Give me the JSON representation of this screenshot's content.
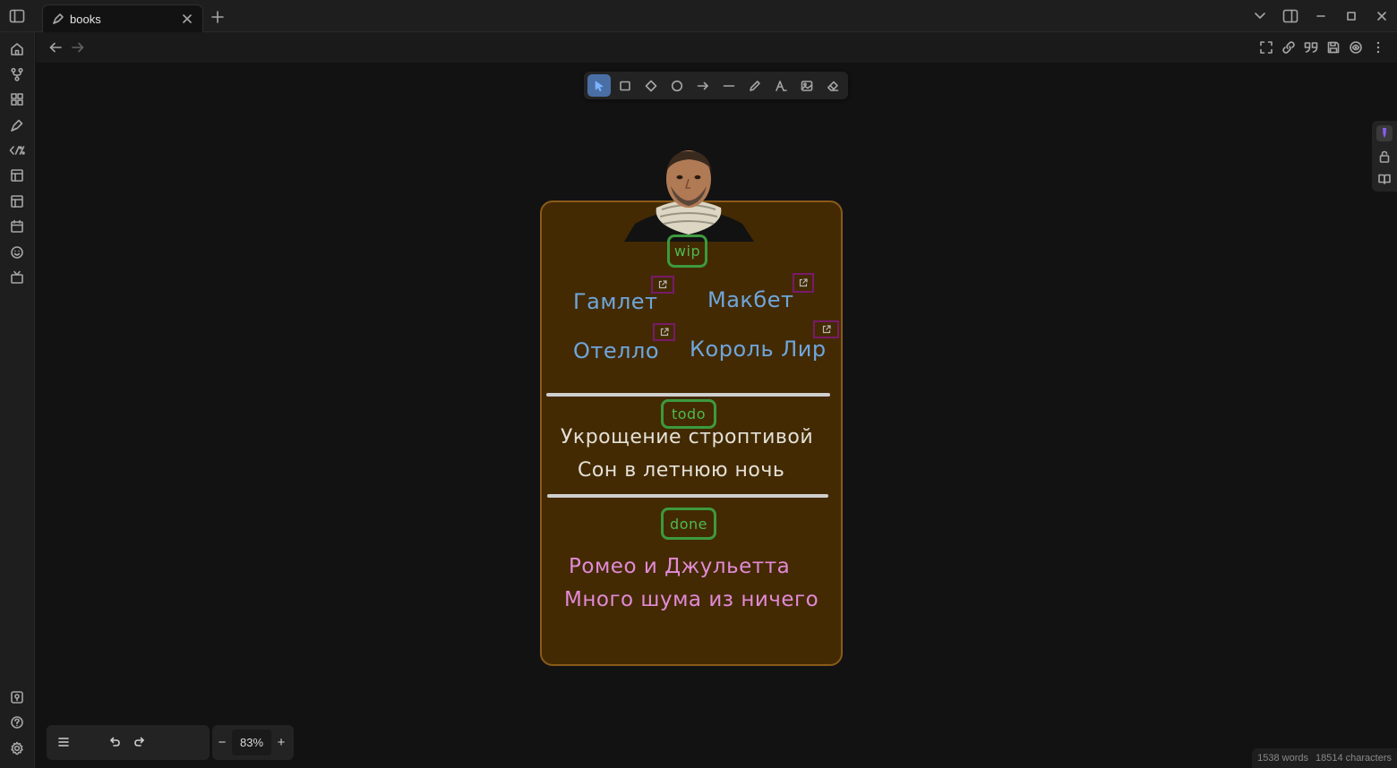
{
  "tab": {
    "title": "books"
  },
  "canvas": {
    "tags": {
      "wip": "wip",
      "todo": "todo",
      "done": "done"
    },
    "wip_books": [
      "Гамлет",
      "Макбет",
      "Отелло",
      "Король Лир"
    ],
    "todo_books": [
      "Укрощение строптивой",
      "Сон в летнюю ночь"
    ],
    "done_books": [
      "Ромео и Джульетта",
      "Много шума из ничего"
    ]
  },
  "zoom": {
    "level": "83%",
    "minus": "−",
    "plus": "+"
  },
  "status": {
    "words": "1538 words",
    "characters": "18514 characters"
  },
  "colors": {
    "accent": "#4a6fa5",
    "card_bg": "#432a02",
    "tag_green": "#3d9a3d",
    "book_blue": "#6fa6dc",
    "book_pink": "#e28ad6",
    "link_purple": "#7a1a6a"
  }
}
